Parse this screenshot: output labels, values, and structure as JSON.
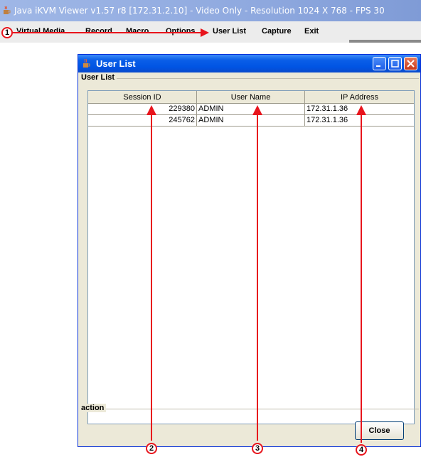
{
  "main_window": {
    "title": "Java iKVM Viewer v1.57 r8 [172.31.2.10] - Video Only - Resolution 1024 X 768 - FPS 30"
  },
  "menu": {
    "items": [
      "Virtual Media",
      "Record",
      "Macro",
      "Options",
      "User List",
      "Capture",
      "Exit"
    ]
  },
  "dialog": {
    "title": "User List",
    "group_user_list": "User List",
    "columns": [
      "Session ID",
      "User Name",
      "IP Address"
    ],
    "rows": [
      [
        "229380",
        "ADMIN",
        "172.31.1.36"
      ],
      [
        "245762",
        "ADMIN",
        "172.31.1.36"
      ]
    ],
    "group_action": "action",
    "close_button": "Close"
  },
  "callouts": [
    "1",
    "2",
    "3",
    "4"
  ],
  "colors": {
    "annotation_red": "#e8141c",
    "xp_title_blue": "#0054e3",
    "dialog_bg": "#ece9d8"
  },
  "icons": {
    "app": "java-cup-icon",
    "minimize": "minimize-icon",
    "maximize": "maximize-icon",
    "close": "close-icon"
  }
}
